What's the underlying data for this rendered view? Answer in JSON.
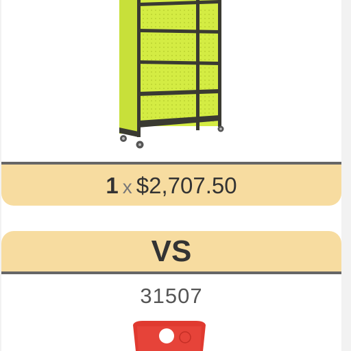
{
  "first_product": {
    "image_name": "green-mobile-bookcase",
    "quantity": "1",
    "multiply_symbol": "x",
    "price": "$2,707.50"
  },
  "comparison": {
    "label": "VS"
  },
  "second_product": {
    "sku": "31507",
    "image_name": "red-cushion-seat"
  },
  "colors": {
    "accent_bar": "#f7dca0",
    "divider": "#666666",
    "bookcase_panel": "#d4ec43",
    "bookcase_frame": "#3a3a32",
    "seat_red": "#e03a30"
  }
}
